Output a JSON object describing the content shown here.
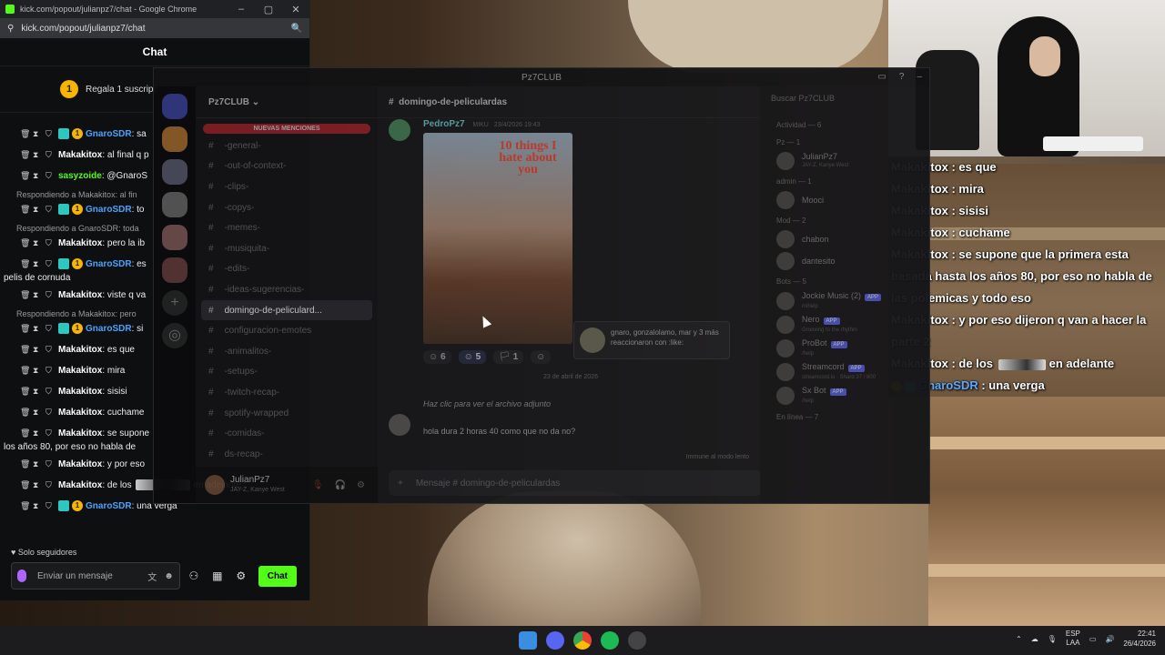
{
  "window": {
    "title": "kick.com/popout/julianpz7/chat - Google Chrome",
    "address": "kick.com/popout/julianpz7/chat",
    "chat_header": "Chat",
    "gift_text": "Regala 1 suscripc",
    "gift_count": "1"
  },
  "kick_chat": {
    "messages": [
      {
        "user": "GnaroSDR",
        "text": ": sa",
        "color": "blue",
        "badges": [
          "sub",
          "coin"
        ]
      },
      {
        "user": "Makakitox",
        "text": ": al final q p",
        "color": "white",
        "badges": []
      },
      {
        "user": "sasyzoide",
        "text": ": @GnaroS",
        "color": "green",
        "badges": []
      },
      {
        "reply": "Respondiendo a Makakitox: al fin"
      },
      {
        "user": "GnaroSDR",
        "text": ": to",
        "color": "blue",
        "badges": [
          "sub",
          "coin"
        ]
      },
      {
        "reply": "Respondiendo a GnaroSDR: toda"
      },
      {
        "user": "Makakitox",
        "text": ": pero la ib",
        "color": "white",
        "badges": []
      },
      {
        "user": "GnaroSDR",
        "text": ": es",
        "color": "blue",
        "badges": [
          "sub",
          "coin"
        ],
        "cont": "pelis de cornuda"
      },
      {
        "user": "Makakitox",
        "text": ": viste q va",
        "color": "white",
        "badges": []
      },
      {
        "reply": "Respondiendo a Makakitox: pero"
      },
      {
        "user": "GnaroSDR",
        "text": ": si",
        "color": "blue",
        "badges": [
          "sub",
          "coin"
        ]
      },
      {
        "user": "Makakitox",
        "text": ": es que",
        "color": "white",
        "badges": []
      },
      {
        "user": "Makakitox",
        "text": ": mira",
        "color": "white",
        "badges": []
      },
      {
        "user": "Makakitox",
        "text": ": sisisi",
        "color": "white",
        "badges": []
      },
      {
        "user": "Makakitox",
        "text": ": cuchame",
        "color": "white",
        "badges": []
      },
      {
        "user": "Makakitox",
        "text": ": se supone",
        "color": "white",
        "badges": [],
        "cont": "los años 80, por eso no habla de"
      },
      {
        "user": "Makakitox",
        "text": ": y por eso",
        "color": "white",
        "badges": []
      },
      {
        "user": "Makakitox",
        "text": ": de los",
        "color": "white",
        "badges": [],
        "tail": "en adeiante"
      },
      {
        "user": "GnaroSDR",
        "text": ": una verga",
        "color": "blue",
        "badges": [
          "sub",
          "coin"
        ]
      }
    ],
    "followers_only": "Solo seguidores",
    "input_placeholder": "Enviar un mensaje",
    "send_label": "Chat"
  },
  "discord": {
    "title": "Pz7CLUB",
    "server_name": "Pz7CLUB",
    "new_mentions": "NUEVAS MENCIONES",
    "channels": [
      "-general-",
      "-out-of-context-",
      "-clips-",
      "-copys-",
      "-memes-",
      "-musiquita-",
      "-edits-",
      "-ideas-sugerencias-",
      "domingo-de-peliculard...",
      "configuracion-emotes",
      "-animalitos-",
      "-setups-",
      "-twitch-recap-",
      "spotify-wrapped",
      "-comidas-",
      "ds-recap-"
    ],
    "active_channel_index": 8,
    "channel_header": "domingo-de-peliculardas",
    "post_author": "PedroPz7",
    "post_tag": "MIKU",
    "post_time": "23/4/2026 19:43",
    "poster_title": "10 things I hate about you",
    "reactions": [
      "6",
      "5",
      "1"
    ],
    "tooltip_text": "gnaro, gonzalolamo, mar y 3 más reaccionaron con :like:",
    "date_divider": "23 de abril de 2026",
    "reply_hint": "Haz clic para ver el archivo adjunto",
    "post2_text": "hola dura 2 horas 40 como que no da no?",
    "slowmode": "Immune al modo lento",
    "composer_placeholder": "Mensaje # domingo-de-peliculardas",
    "user_name": "JulianPz7",
    "user_status": "JAY-Z, Kanye West",
    "search": "Buscar Pz7CLUB",
    "members": {
      "groups": [
        {
          "label": "Actividad — 6",
          "items": []
        },
        {
          "label": "Pz — 1",
          "items": [
            {
              "name": "JulianPz7",
              "sub": "JAY-Z, Kanye West"
            }
          ]
        },
        {
          "label": "admin — 1",
          "items": [
            {
              "name": "Mooci",
              "sub": ""
            }
          ]
        },
        {
          "label": "Mod — 2",
          "items": [
            {
              "name": "chabon",
              "sub": ""
            },
            {
              "name": "dantesito",
              "sub": ""
            }
          ]
        },
        {
          "label": "Bots — 5",
          "items": [
            {
              "name": "Jockie Music (2)",
              "sub": "mihelp",
              "app": true
            },
            {
              "name": "Nero",
              "sub": "Grooving to the rhythm",
              "app": true
            },
            {
              "name": "ProBot",
              "sub": "/help",
              "app": true
            },
            {
              "name": "Streamcord",
              "sub": "streamcord.io · Shard 37 / 800",
              "app": true
            },
            {
              "name": "Sx Bot",
              "sub": "/help",
              "app": true
            }
          ]
        },
        {
          "label": "En línea — 7",
          "items": []
        }
      ]
    }
  },
  "overlay_chat": [
    {
      "user": "Makakitox",
      "text": " : es que"
    },
    {
      "user": "Makakitox",
      "text": " : mira"
    },
    {
      "user": "Makakitox",
      "text": " : sisisi"
    },
    {
      "user": "Makakitox",
      "text": " : cuchame"
    },
    {
      "user": "Makakitox",
      "text": " : se supone que la primera esta basada hasta los años 80, por eso no habla de las polemicas y todo eso"
    },
    {
      "user": "Makakitox",
      "text": " : y por eso dijeron q van a hacer la parte 2"
    },
    {
      "user": "Makakitox",
      "text": " : de los",
      "tail": " en adelante"
    },
    {
      "user": "GnaroSDR",
      "text": " : una verga",
      "blue": true
    }
  ],
  "taskbar": {
    "lang1": "ESP",
    "lang2": "LAA",
    "time": "22:41",
    "date": "26/4/2026"
  },
  "colors": {
    "kick_green": "#53fc18",
    "discord_blurple": "#5865f2",
    "mention_red": "#c5262f"
  }
}
